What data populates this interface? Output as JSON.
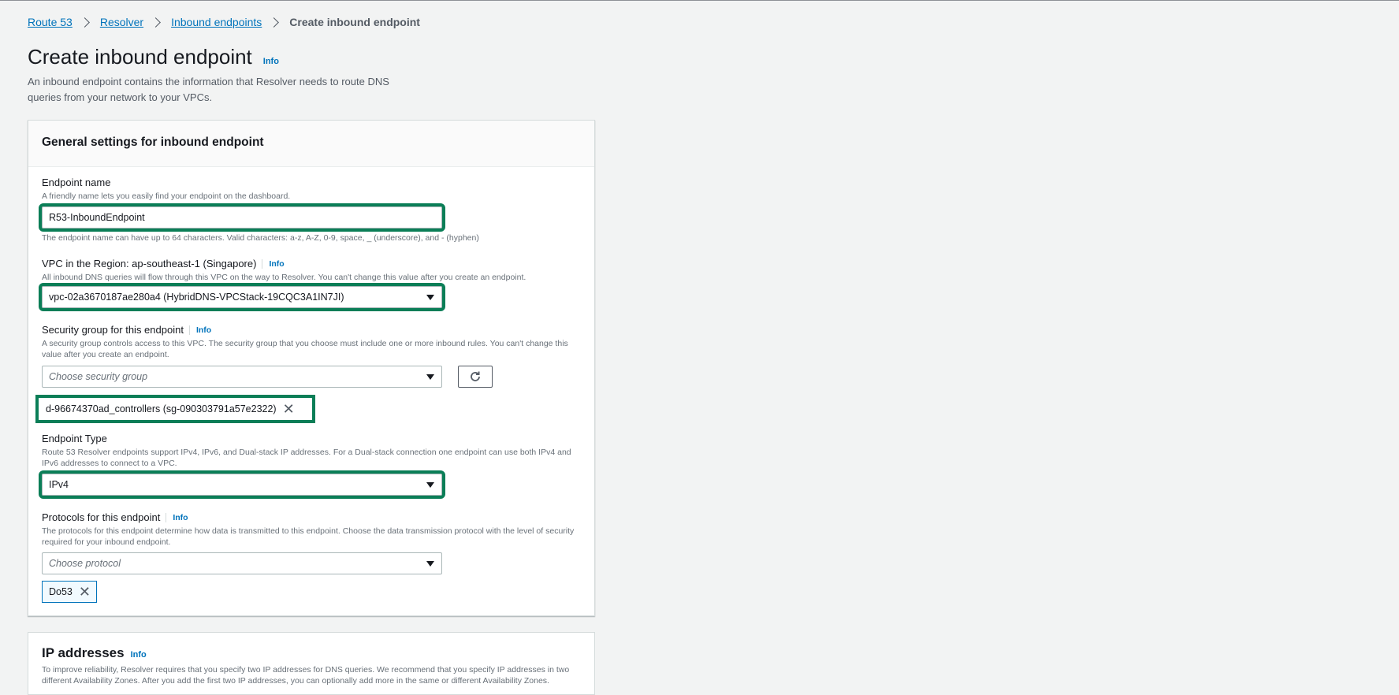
{
  "breadcrumb": [
    "Route 53",
    "Resolver",
    "Inbound endpoints",
    "Create inbound endpoint"
  ],
  "header": {
    "title": "Create inbound endpoint",
    "info": "Info",
    "description": "An inbound endpoint contains the information that Resolver needs to route DNS queries from your network to your VPCs."
  },
  "general": {
    "title": "General settings for inbound endpoint",
    "endpoint_name": {
      "label": "Endpoint name",
      "description": "A friendly name lets you easily find your endpoint on the dashboard.",
      "value": "R53-InboundEndpoint",
      "constraint": "The endpoint name can have up to 64 characters. Valid characters: a-z, A-Z, 0-9, space, _ (underscore), and - (hyphen)"
    },
    "vpc": {
      "label": "VPC in the Region: ap-southeast-1 (Singapore)",
      "info": "Info",
      "description": "All inbound DNS queries will flow through this VPC on the way to Resolver. You can't change this value after you create an endpoint.",
      "value": "vpc-02a3670187ae280a4 (HybridDNS-VPCStack-19CQC3A1IN7JI)"
    },
    "security_group": {
      "label": "Security group for this endpoint",
      "info": "Info",
      "description": "A security group controls access to this VPC. The security group that you choose must include one or more inbound rules. You can't change this value after you create an endpoint.",
      "placeholder": "Choose security group",
      "selected": "d-96674370ad_controllers (sg-090303791a57e2322)"
    },
    "endpoint_type": {
      "label": "Endpoint Type",
      "description": "Route 53 Resolver endpoints support IPv4, IPv6, and Dual-stack IP addresses. For a Dual-stack connection one endpoint can use both IPv4 and IPv6 addresses to connect to a VPC.",
      "value": "IPv4"
    },
    "protocols": {
      "label": "Protocols for this endpoint",
      "info": "Info",
      "description": "The protocols for this endpoint determine how data is transmitted to this endpoint. Choose the data transmission protocol with the level of security required for your inbound endpoint.",
      "placeholder": "Choose protocol",
      "selected": "Do53"
    }
  },
  "ip_addresses": {
    "title": "IP addresses",
    "info": "Info",
    "description": "To improve reliability, Resolver requires that you specify two IP addresses for DNS queries. We recommend that you specify IP addresses in two different Availability Zones. After you add the first two IP addresses, you can optionally add more in the same or different Availability Zones."
  },
  "colors": {
    "link": "#0073bb",
    "highlight": "#0b7e57"
  },
  "icons": {
    "separator": "chevron-right-icon",
    "dropdown": "caret-down-icon",
    "refresh": "refresh-icon",
    "remove": "close-icon"
  }
}
